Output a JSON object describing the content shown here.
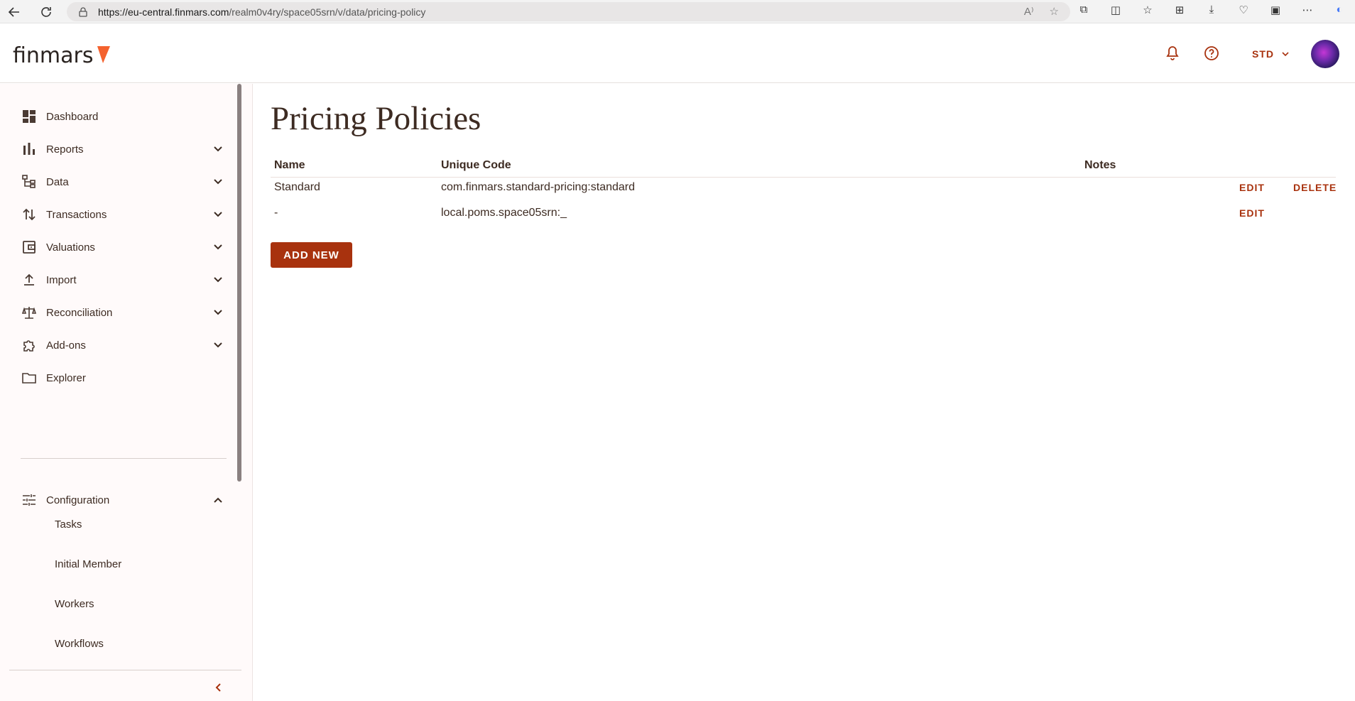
{
  "browser": {
    "url_host": "https://eu-central.finmars.com",
    "url_path": "/realm0v4ry/space05srn/v/data/pricing-policy"
  },
  "header": {
    "logo_text": "finmars",
    "space_label": "STD",
    "brand_color": "#f4622e",
    "accent_color": "#a8320e"
  },
  "sidebar": {
    "items": [
      {
        "label": "Dashboard",
        "icon": "dashboard-icon",
        "expandable": false
      },
      {
        "label": "Reports",
        "icon": "bar-chart-icon",
        "expandable": true
      },
      {
        "label": "Data",
        "icon": "data-tree-icon",
        "expandable": true
      },
      {
        "label": "Transactions",
        "icon": "swap-vertical-icon",
        "expandable": true
      },
      {
        "label": "Valuations",
        "icon": "wallet-icon",
        "expandable": true
      },
      {
        "label": "Import",
        "icon": "upload-icon",
        "expandable": true
      },
      {
        "label": "Reconciliation",
        "icon": "scale-icon",
        "expandable": true
      },
      {
        "label": "Add-ons",
        "icon": "puzzle-icon",
        "expandable": true
      },
      {
        "label": "Explorer",
        "icon": "folder-icon",
        "expandable": false
      }
    ],
    "configuration": {
      "label": "Configuration",
      "icon": "tune-icon",
      "expanded": true,
      "children": [
        "Tasks",
        "Initial Member",
        "Workers",
        "Workflows"
      ]
    }
  },
  "main": {
    "title": "Pricing Policies",
    "columns": [
      "Name",
      "Unique Code",
      "Notes"
    ],
    "rows": [
      {
        "name": "Standard",
        "unique_code": "com.finmars.standard-pricing:standard",
        "notes": "",
        "edit": "EDIT",
        "delete": "DELETE"
      },
      {
        "name": "-",
        "unique_code": "local.poms.space05srn:_",
        "notes": "",
        "edit": "EDIT",
        "delete": ""
      }
    ],
    "add_button": "ADD NEW"
  }
}
